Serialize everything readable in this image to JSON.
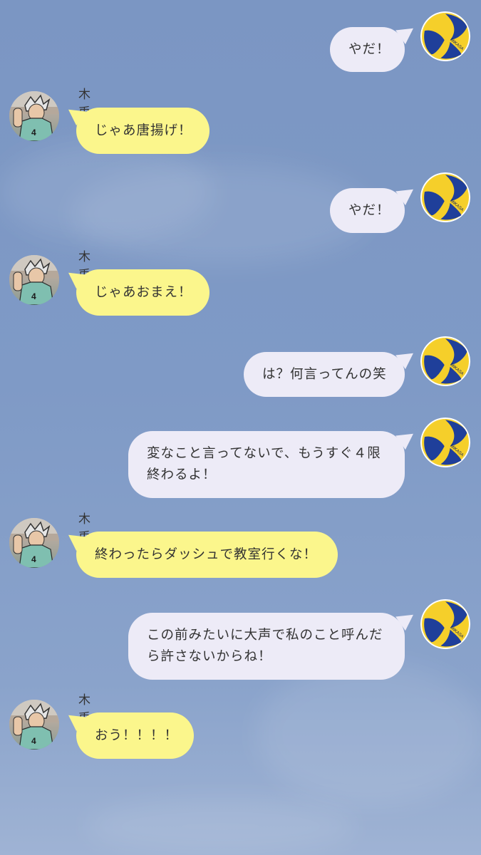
{
  "chat": {
    "friend_name": "木兎",
    "messages": [
      {
        "from": "me",
        "text": "やだ！"
      },
      {
        "from": "friend",
        "text": "じゃあ唐揚げ！"
      },
      {
        "from": "me",
        "text": "やだ！"
      },
      {
        "from": "friend",
        "text": "じゃあおまえ！"
      },
      {
        "from": "me",
        "text": "は？何言ってんの笑"
      },
      {
        "from": "me",
        "text": "変なこと言ってないで、もうすぐ４限\n終わるよ！"
      },
      {
        "from": "friend",
        "text": "終わったらダッシュで教室行くな！"
      },
      {
        "from": "me",
        "text": "この前みたいに大声で私のこと呼んだ\nら許さないからね！"
      },
      {
        "from": "friend",
        "text": "おう！！！！"
      }
    ]
  },
  "icons": {
    "me_avatar": "volleyball-icon",
    "friend_avatar": "character-avatar"
  },
  "colors": {
    "background": "#7b96c3",
    "my_bubble": "#edebf7",
    "friend_bubble": "#fbf68c"
  }
}
